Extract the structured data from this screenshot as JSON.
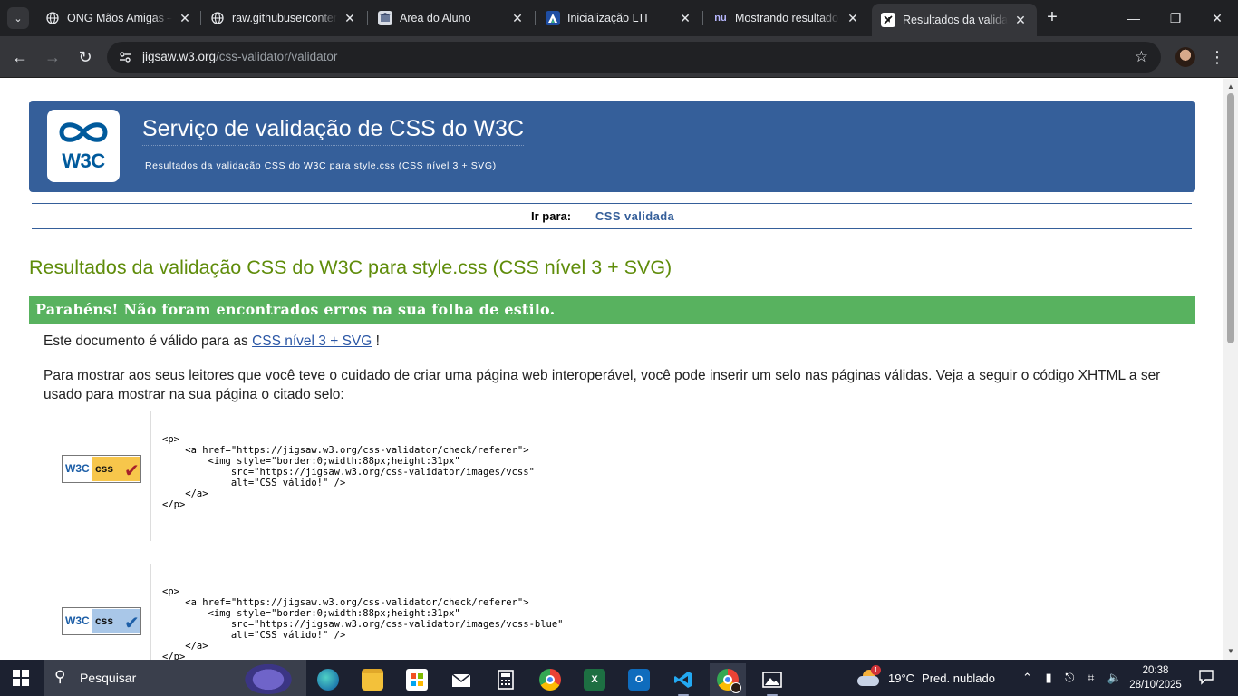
{
  "browser": {
    "tab_search_icon": "chevron-down-icon",
    "tabs": [
      {
        "title": "ONG Mãos Amigas —",
        "favicon": "globe-icon"
      },
      {
        "title": "raw.githubuserconten",
        "favicon": "globe-icon"
      },
      {
        "title": "Area do Aluno",
        "favicon": "school-icon"
      },
      {
        "title": "Inicialização LTI",
        "favicon": "lti-icon"
      },
      {
        "title": "Mostrando resultado",
        "favicon": "nu-icon"
      },
      {
        "title": "Resultados da validaç",
        "favicon": "w3c-icon",
        "active": true
      }
    ],
    "url_host": "jigsaw.w3.org",
    "url_path": "/css-validator/validator"
  },
  "header": {
    "title": "Serviço de validação de CSS do W3C",
    "subtitle": "Resultados da validação CSS do W3C para style.css (CSS nível 3 + SVG)",
    "logo_text": "W3C"
  },
  "jump": {
    "label": "Ir para:",
    "link": "CSS validada"
  },
  "results": {
    "heading": "Resultados da validação CSS do W3C para style.css (CSS nível 3 + SVG)",
    "congrats": "Parabéns! Não foram encontrados erros na sua folha de estilo.",
    "valid_prefix": "Este documento é válido para as",
    "valid_link": "CSS nível 3 + SVG",
    "valid_suffix": "!",
    "badge_intro": "Para mostrar aos seus leitores que você teve o cuidado de criar uma página web interoperável, você pode inserir um selo nas páginas válidas. Veja a seguir o código XHTML a ser usado para mostrar na sua página o citado selo:"
  },
  "badges": [
    {
      "w3c": "W3C",
      "css": "css",
      "color": "#f7c64b",
      "check_color": "#a61f2a",
      "code": "<p>\n    <a href=\"https://jigsaw.w3.org/css-validator/check/referer\">\n        <img style=\"border:0;width:88px;height:31px\"\n            src=\"https://jigsaw.w3.org/css-validator/images/vcss\"\n            alt=\"CSS válido!\" />\n    </a>\n</p>"
    },
    {
      "w3c": "W3C",
      "css": "css",
      "color": "#a9c7e8",
      "check_color": "#1c5ea7",
      "code": "<p>\n    <a href=\"https://jigsaw.w3.org/css-validator/check/referer\">\n        <img style=\"border:0;width:88px;height:31px\"\n            src=\"https://jigsaw.w3.org/css-validator/images/vcss-blue\"\n            alt=\"CSS válido!\" />\n    </a>\n</p>"
    }
  ],
  "taskbar": {
    "search_placeholder": "Pesquisar",
    "weather_temp": "19°C",
    "weather_text": "Pred. nublado",
    "weather_alert": "1",
    "time": "20:38",
    "date": "28/10/2025"
  },
  "colors": {
    "banner": "#355f9a",
    "heading_green": "#5f8c0a",
    "congrats_green": "#58b25f",
    "link_blue": "#2a56a5"
  }
}
